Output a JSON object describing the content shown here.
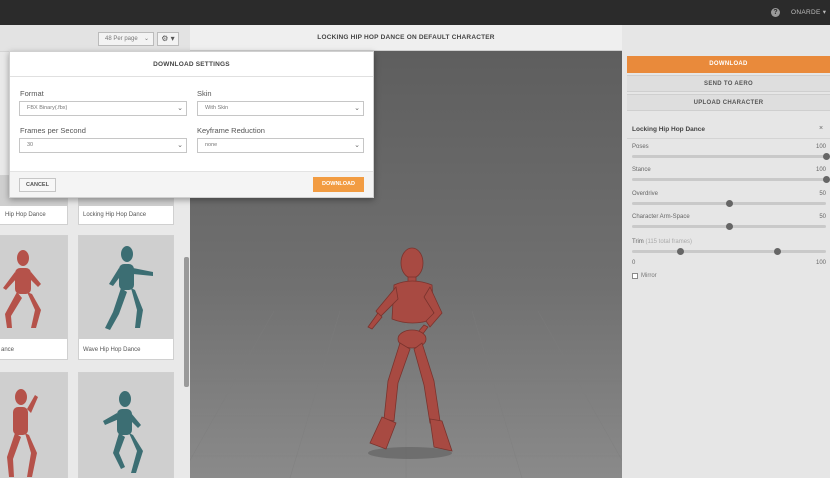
{
  "topbar": {
    "help_icon": "?",
    "user": "ONARDE ▾"
  },
  "library": {
    "per_page": "48 Per page",
    "gear_label": "⚙ ▾",
    "cards": [
      {
        "label": "Hip Hop Dance"
      },
      {
        "label": "Locking Hip Hop Dance"
      },
      {
        "label": "ance"
      },
      {
        "label": "Wave Hip Hop Dance"
      }
    ]
  },
  "viewer": {
    "title": "LOCKING HIP HOP DANCE ON DEFAULT CHARACTER"
  },
  "side": {
    "download": "DOWNLOAD",
    "send_to_aero": "SEND TO AERO",
    "upload_character": "UPLOAD CHARACTER",
    "animation_title": "Locking Hip Hop Dance",
    "close_icon": "×",
    "sliders": [
      {
        "label": "Poses",
        "value": "100",
        "level": 1.0
      },
      {
        "label": "Stance",
        "value": "100",
        "level": 1.0
      },
      {
        "label": "Overdrive",
        "value": "50",
        "level": 0.5
      },
      {
        "label": "Character Arm-Space",
        "value": "50",
        "level": 0.5
      }
    ],
    "trim": {
      "label": "Trim",
      "sub": "(115 total frames)",
      "min": "0",
      "max": "100",
      "range": [
        0.25,
        0.75
      ]
    },
    "mirror": "Mirror"
  },
  "modal": {
    "title": "DOWNLOAD SETTINGS",
    "format_label": "Format",
    "format_value": "FBX Binary(.fbx)",
    "skin_label": "Skin",
    "skin_value": "With Skin",
    "fps_label": "Frames per Second",
    "fps_value": "30",
    "keyframe_label": "Keyframe Reduction",
    "keyframe_value": "none",
    "cancel": "CANCEL",
    "download": "DOWNLOAD",
    "chevron": "⌄"
  },
  "colors": {
    "accent": "#f29c42",
    "figure_red": "#b5524a",
    "figure_teal": "#3c6e73"
  }
}
